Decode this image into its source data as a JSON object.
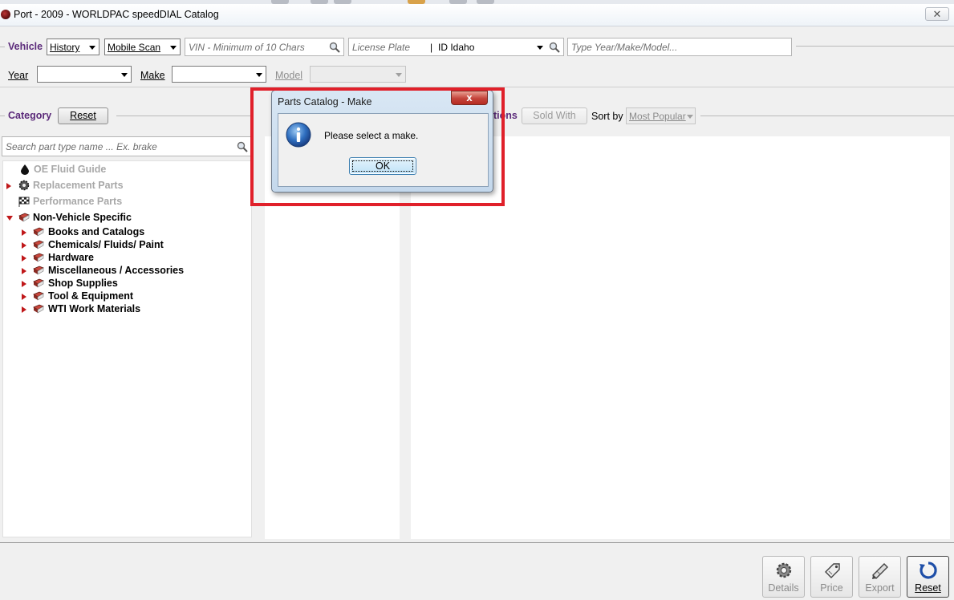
{
  "window": {
    "title": "Port - 2009 - WORLDPAC speedDIAL Catalog",
    "close_glyph": "✕"
  },
  "vehicle_bar": {
    "label": "Vehicle",
    "history": "History",
    "mobile_scan": "Mobile Scan",
    "vin_placeholder": "VIN - Minimum of 10 Chars",
    "plate_placeholder": "License Plate",
    "state_value": "ID Idaho",
    "ymm_placeholder": "Type Year/Make/Model..."
  },
  "ymm_row": {
    "year_label": "Year",
    "year_value": "",
    "make_label": "Make",
    "make_value": "",
    "model_label": "Model",
    "model_value": ""
  },
  "category": {
    "label": "Category",
    "reset": "Reset",
    "search_placeholder": "Search part type name ... Ex. brake"
  },
  "results_bar": {
    "positions_fragment": "tions",
    "sold_with": "Sold With",
    "sort_by": "Sort by",
    "sort_value": "Most Popular"
  },
  "tree": [
    {
      "label": "OE Fluid Guide",
      "disabled": true,
      "icon": "drop-icon"
    },
    {
      "label": "Replacement Parts",
      "disabled": true,
      "icon": "gear-icon"
    },
    {
      "label": "Performance Parts",
      "disabled": true,
      "icon": "checkered-flag-icon"
    },
    {
      "label": "Non-Vehicle Specific",
      "disabled": false,
      "icon": "books-icon",
      "expanded": true
    },
    {
      "label": "Books and Catalogs",
      "disabled": false,
      "icon": "books-icon"
    },
    {
      "label": "Chemicals/ Fluids/ Paint",
      "disabled": false,
      "icon": "books-icon"
    },
    {
      "label": "Hardware",
      "disabled": false,
      "icon": "books-icon"
    },
    {
      "label": "Miscellaneous / Accessories",
      "disabled": false,
      "icon": "books-icon"
    },
    {
      "label": "Shop Supplies",
      "disabled": false,
      "icon": "books-icon"
    },
    {
      "label": "Tool & Equipment",
      "disabled": false,
      "icon": "books-icon"
    },
    {
      "label": "WTI Work Materials",
      "disabled": false,
      "icon": "books-icon"
    }
  ],
  "dialog": {
    "title": "Parts Catalog - Make",
    "close_glyph": "x",
    "message": "Please select a make.",
    "ok": "OK",
    "icon": "info-icon"
  },
  "bottom_buttons": [
    {
      "label": "Details",
      "icon": "gear-icon",
      "active": false
    },
    {
      "label": "Price",
      "icon": "price-tag-icon",
      "active": false
    },
    {
      "label": "Export",
      "icon": "export-icon",
      "active": false
    },
    {
      "label": "Reset",
      "icon": "reset-icon",
      "active": true
    }
  ],
  "colors": {
    "section_label": "#5b2a7a",
    "tree_triangle": "#c0181a",
    "highlight": "#e0202a"
  }
}
